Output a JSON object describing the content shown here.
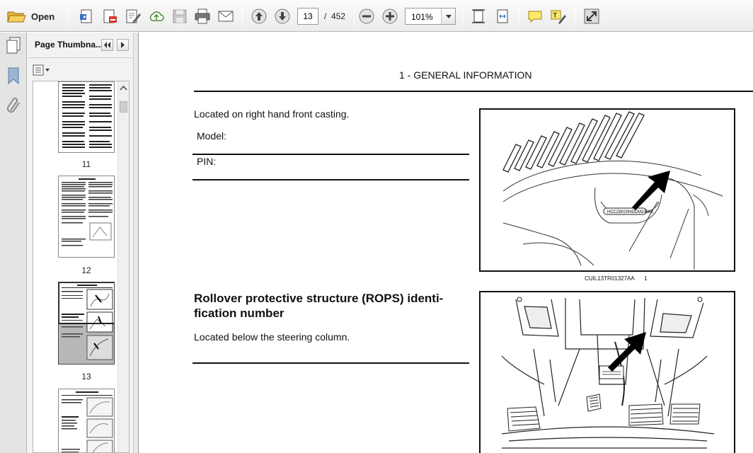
{
  "toolbar": {
    "open_label": "Open",
    "page_current": "13",
    "page_separator": "/",
    "page_total": "452",
    "zoom_value": "101%",
    "icons": [
      "folder-open-icon",
      "create-pdf-icon",
      "export-pdf-icon",
      "edit-pdf-icon",
      "upload-cloud-icon",
      "save-icon",
      "print-icon",
      "email-icon",
      "previous-page-icon",
      "next-page-icon",
      "zoom-out-icon",
      "zoom-in-icon",
      "fit-page-icon",
      "fit-width-icon",
      "comment-icon",
      "highlight-icon",
      "fullscreen-icon"
    ]
  },
  "sidebar": {
    "panel_title": "Page Thumbna...",
    "rail_icons": [
      "bookmark-icon",
      "attachment-icon",
      "copy-icon"
    ],
    "thumbnails": [
      {
        "label": "11"
      },
      {
        "label": "12"
      },
      {
        "label": "13"
      }
    ]
  },
  "document": {
    "header": "1 - GENERAL INFORMATION",
    "s1_text": "Located on right hand front casting.",
    "model_label": "Model:",
    "pin_label": "PIN:",
    "fig1_plate": "HCCZ8020HDCM10988",
    "fig1_caption": "CUIL13TR01327AA",
    "fig1_number": "1",
    "s2_heading_line1": "Rollover protective structure (ROPS) identi-",
    "s2_heading_line2": "fication number",
    "s2_text": "Located below the steering column."
  }
}
